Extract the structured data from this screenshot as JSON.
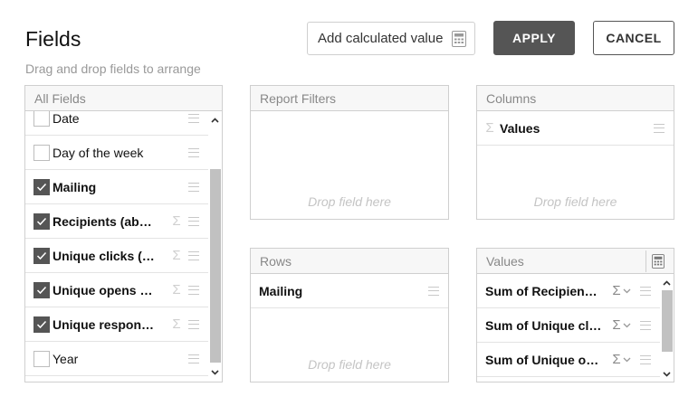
{
  "header": {
    "title": "Fields",
    "subtitle": "Drag and drop fields to arrange",
    "calc_label": "Add calculated value",
    "apply_label": "APPLY",
    "cancel_label": "CANCEL"
  },
  "all_fields": {
    "title": "All Fields",
    "items": [
      {
        "label": "Date",
        "checked": false,
        "sigma": false
      },
      {
        "label": "Day of the week",
        "checked": false,
        "sigma": false
      },
      {
        "label": "Mailing",
        "checked": true,
        "sigma": false
      },
      {
        "label": "Recipients (ab…",
        "checked": true,
        "sigma": true
      },
      {
        "label": "Unique clicks (…",
        "checked": true,
        "sigma": true
      },
      {
        "label": "Unique opens …",
        "checked": true,
        "sigma": true
      },
      {
        "label": "Unique respon…",
        "checked": true,
        "sigma": true
      },
      {
        "label": "Year",
        "checked": false,
        "sigma": false
      }
    ]
  },
  "report_filters": {
    "title": "Report Filters",
    "drop_hint": "Drop field here"
  },
  "columns": {
    "title": "Columns",
    "items": [
      "Values"
    ],
    "drop_hint": "Drop field here"
  },
  "rows": {
    "title": "Rows",
    "items": [
      "Mailing"
    ],
    "drop_hint": "Drop field here"
  },
  "values": {
    "title": "Values",
    "items": [
      "Sum of Recipien…",
      "Sum of Unique cl…",
      "Sum of Unique o…"
    ]
  },
  "colors": {
    "button_dark": "#555555",
    "border": "#cfcfcf",
    "header_bg": "#f7f7f7",
    "hint": "#c4c4c4"
  }
}
